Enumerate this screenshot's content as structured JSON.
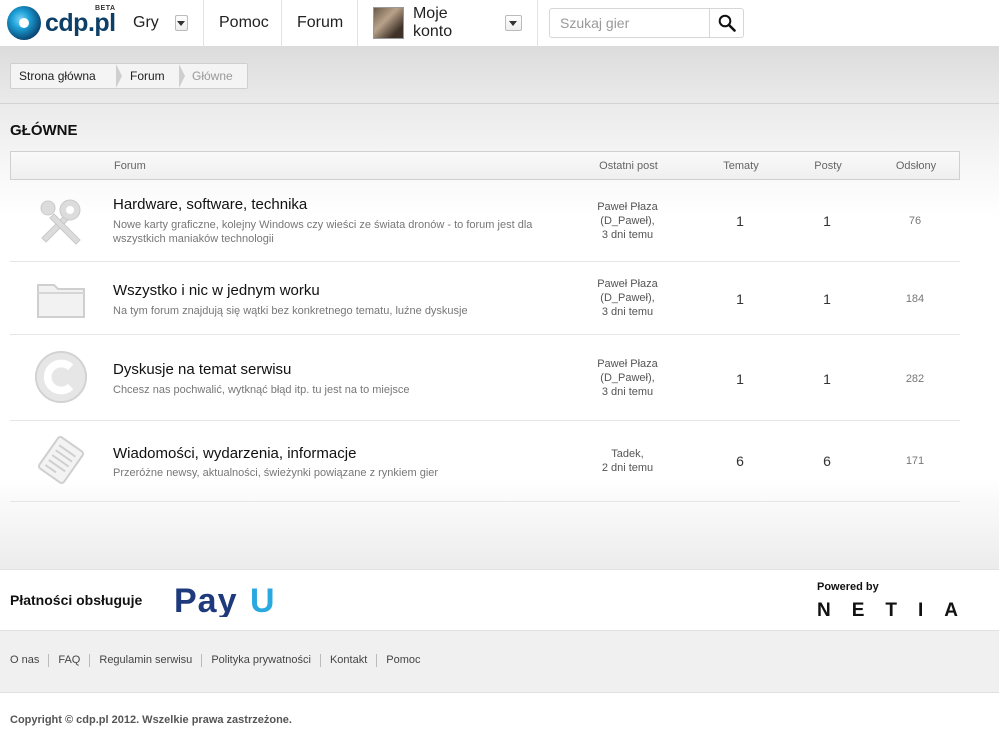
{
  "header": {
    "logo_text": "cdp.pl",
    "logo_badge": "BETA",
    "nav": {
      "games": "Gry",
      "help": "Pomoc",
      "forum": "Forum",
      "account": "Moje konto"
    },
    "search": {
      "placeholder": "Szukaj gier"
    }
  },
  "breadcrumb": [
    "Strona główna",
    "Forum",
    "Główne"
  ],
  "section_title": "GŁÓWNE",
  "table": {
    "columns": [
      "Forum",
      "Ostatni post",
      "Tematy",
      "Posty",
      "Odsłony"
    ],
    "rows": [
      {
        "icon": "tools-icon",
        "title": "Hardware, software, technika",
        "description": "Nowe karty graficzne, kolejny Windows czy wieści ze świata dronów - to forum jest dla wszystkich maniaków technologii",
        "last_post_line1": "Paweł Płaza",
        "last_post_line2": "(D_Paweł),",
        "last_post_line3": "3 dni temu",
        "topics": "1",
        "posts": "1",
        "views": "76"
      },
      {
        "icon": "folder-icon",
        "title": "Wszystko i nic w jednym worku",
        "description": "Na tym forum znajdują się wątki bez konkretnego tematu, luźne dyskusje",
        "last_post_line1": "Paweł Płaza",
        "last_post_line2": "(D_Paweł),",
        "last_post_line3": "3 dni temu",
        "topics": "1",
        "posts": "1",
        "views": "184"
      },
      {
        "icon": "cdp-logo-icon",
        "title": "Dyskusje na temat serwisu",
        "description": "Chcesz nas pochwalić, wytknąć błąd itp. tu jest na to miejsce",
        "last_post_line1": "Paweł Płaza",
        "last_post_line2": "(D_Paweł),",
        "last_post_line3": "3 dni temu",
        "topics": "1",
        "posts": "1",
        "views": "282"
      },
      {
        "icon": "newspaper-icon",
        "title": "Wiadomości, wydarzenia, informacje",
        "description": "Przeróżne newsy, aktualności, świeżynki powiązane z rynkiem gier",
        "last_post_line1": "Tadek,",
        "last_post_line2": "2 dni temu",
        "last_post_line3": "",
        "topics": "6",
        "posts": "6",
        "views": "171"
      }
    ]
  },
  "footer": {
    "payments_label": "Płatności obsługuje",
    "payu_logo_text": "PayU",
    "powered_by": "Powered by",
    "netia": "NETIA",
    "links": [
      "O nas",
      "FAQ",
      "Regulamin serwisu",
      "Polityka prywatności",
      "Kontakt",
      "Pomoc"
    ],
    "copyright": "Copyright © cdp.pl 2012. Wszelkie prawa zastrzeżone."
  },
  "colors": {
    "brand_navy": "#0d3f67",
    "payu_blue": "#1e3a7d",
    "payu_accent": "#2aa8e0"
  }
}
